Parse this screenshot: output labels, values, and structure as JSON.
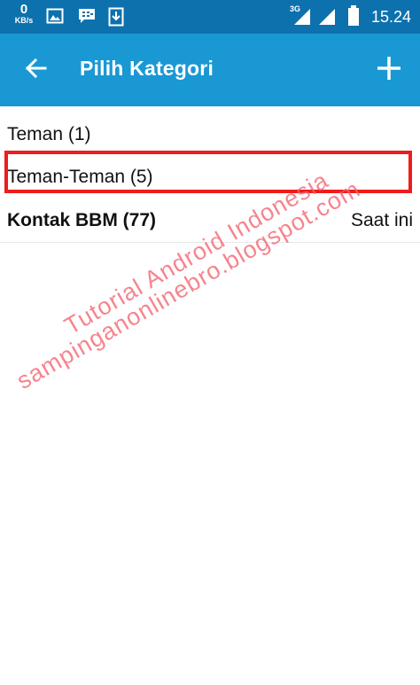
{
  "status_bar": {
    "net_speed_value": "0",
    "net_speed_unit": "KB/s",
    "network_type": "3G",
    "time": "15.24",
    "icons": [
      "image-icon",
      "bbm-icon",
      "download-icon",
      "signal-icon",
      "signal-icon",
      "battery-icon"
    ]
  },
  "app_bar": {
    "title": "Pilih Kategori",
    "back_icon": "arrow-left-icon",
    "add_icon": "plus-icon"
  },
  "list": {
    "items": [
      {
        "label": "Teman (1)",
        "meta": ""
      },
      {
        "label": "Teman-Teman (5)",
        "meta": ""
      },
      {
        "label": "Kontak BBM (77)",
        "meta": "Saat ini"
      }
    ]
  },
  "watermark": {
    "line1": "Tutorial Android Indonesia",
    "line2": "sampinganonlinebro.blogspot.com"
  },
  "colors": {
    "status_bar": "#0d71ad",
    "app_bar": "#1a98d4",
    "highlight": "#ee1c1c",
    "watermark": "#f4626e"
  }
}
